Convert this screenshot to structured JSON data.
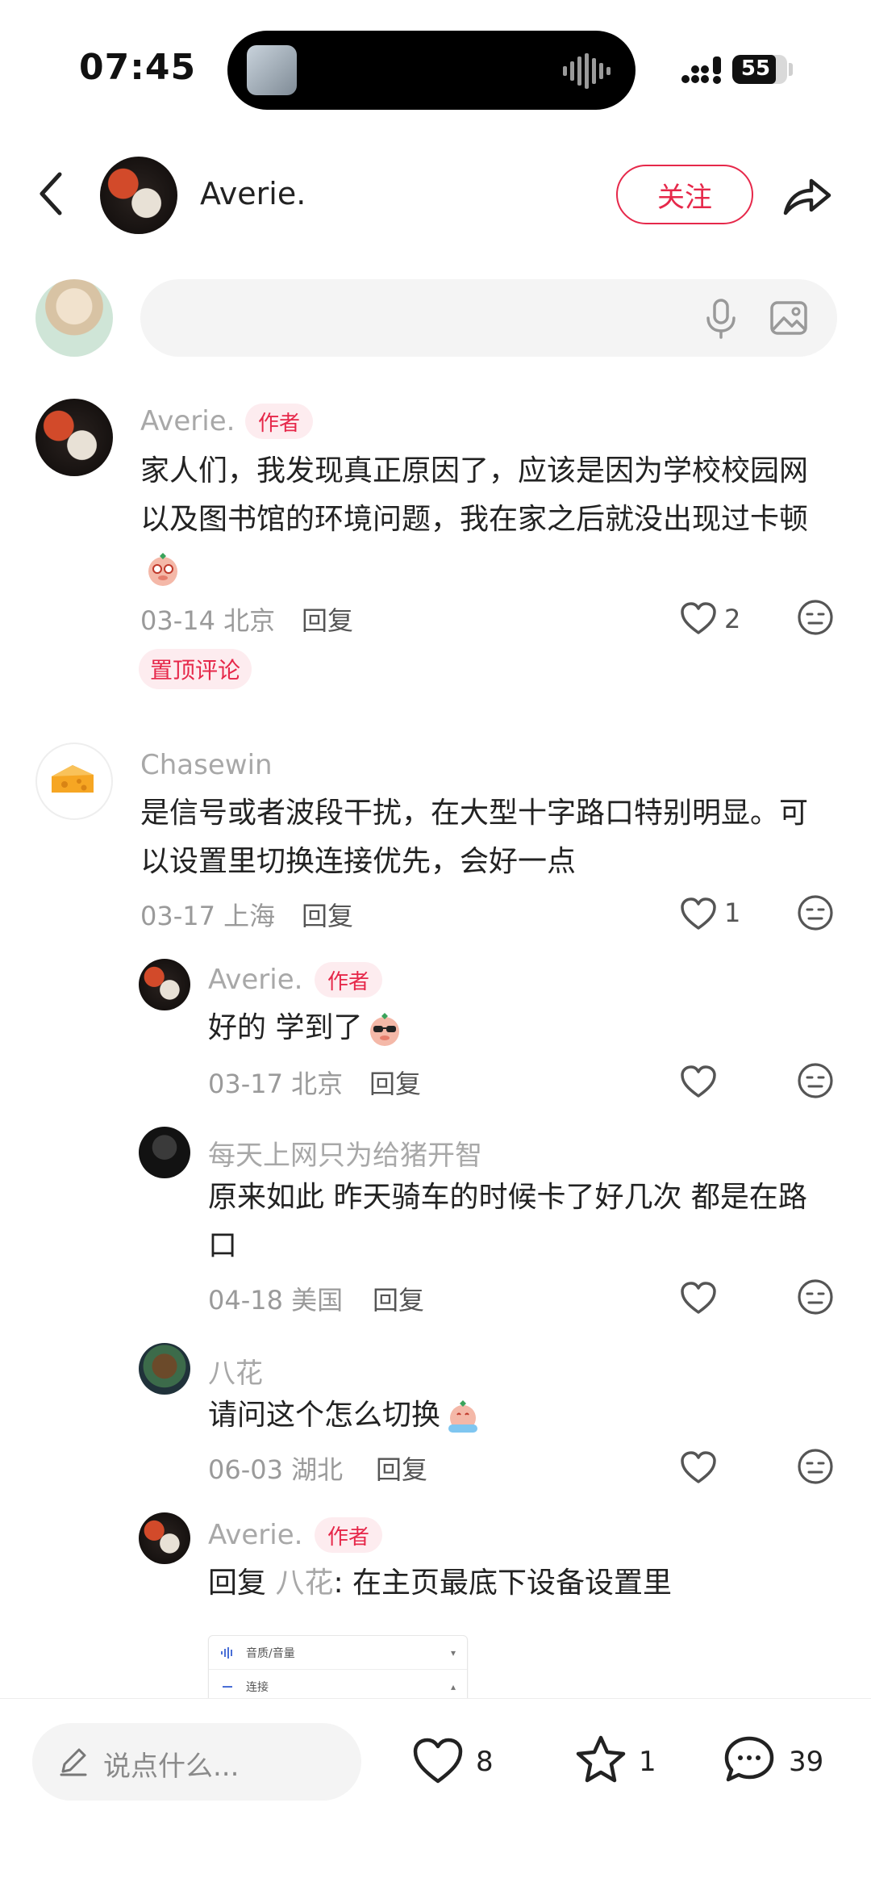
{
  "status": {
    "time": "07:45",
    "battery": "55"
  },
  "header": {
    "username": "Averie.",
    "follow_label": "关注"
  },
  "input": {
    "placeholder": ""
  },
  "comments": [
    {
      "name": "Averie.",
      "tag": "作者",
      "text_lines": [
        "家人们，我发现真正原因了，应该是因为学校校园网",
        "以及图书馆的环境问题，我在家之后就没出现过卡顿"
      ],
      "date_loc": "03-14 北京",
      "reply": "回复",
      "likes": "2",
      "pinned": "置顶评论"
    },
    {
      "name": "Chasewin",
      "text_lines": [
        "是信号或者波段干扰，在大型十字路口特别明显。可",
        "以设置里切换连接优先，会好一点"
      ],
      "date_loc": "03-17 上海",
      "reply": "回复",
      "likes": "1"
    }
  ],
  "replies": [
    {
      "name": "Averie.",
      "tag": "作者",
      "text": "好的 学到了",
      "date_loc": "03-17 北京",
      "reply": "回复"
    },
    {
      "name": "每天上网只为给猪开智",
      "text_lines": [
        "原来如此 昨天骑车的时候卡了好几次 都是在路",
        "口"
      ],
      "date_loc": "04-18 美国",
      "reply": "回复"
    },
    {
      "name": "八花",
      "text": "请问这个怎么切换",
      "date_loc": "06-03 湖北",
      "reply": "回复"
    },
    {
      "name": "Averie.",
      "tag": "作者",
      "reply_prefix": "回复 ",
      "reply_to": "八花",
      "text": ": 在主页最底下设备设置里"
    }
  ],
  "screenshot": {
    "row1": "音质/音量",
    "row2": "连接"
  },
  "bottom": {
    "say_placeholder": "说点什么...",
    "likes": "8",
    "stars": "1",
    "comments": "39"
  }
}
